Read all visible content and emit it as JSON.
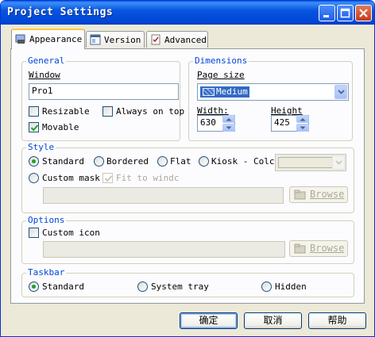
{
  "window": {
    "title": "Project Settings",
    "controls": [
      "minimize-icon",
      "maximize-icon",
      "close-icon"
    ]
  },
  "tabs": [
    {
      "label": "Appearance",
      "icon": "appearance-icon",
      "active": true
    },
    {
      "label": "Version",
      "icon": "version-icon",
      "active": false
    },
    {
      "label": "Advanced",
      "icon": "advanced-icon",
      "active": false
    }
  ],
  "general": {
    "title": "General",
    "window_label": "Window",
    "window_value": "Pro1",
    "resizable_label": "Resizable",
    "resizable_checked": false,
    "always_on_top_label": "Always on top",
    "always_on_top_checked": false,
    "movable_label": "Movable",
    "movable_checked": true
  },
  "dimensions": {
    "title": "Dimensions",
    "page_size_label": "Page size",
    "page_size_value": "Medium",
    "width_label": "Width:",
    "width_value": "630",
    "height_label": "Height",
    "height_value": "425"
  },
  "style": {
    "title": "Style",
    "options": [
      {
        "label": "Standard",
        "selected": true
      },
      {
        "label": "Bordered",
        "selected": false
      },
      {
        "label": "Flat",
        "selected": false
      },
      {
        "label": "Kiosk - Colc",
        "selected": false
      },
      {
        "label": "Custom mask",
        "selected": false
      }
    ],
    "fit_label": "Fit to windc",
    "fit_checked": true,
    "color_value": "",
    "mask_path": "",
    "browse_label": "Browse"
  },
  "options": {
    "title": "Options",
    "custom_icon_label": "Custom icon",
    "custom_icon_checked": false,
    "icon_path": "",
    "browse_label": "Browse"
  },
  "taskbar": {
    "title": "Taskbar",
    "options": [
      {
        "label": "Standard",
        "selected": true
      },
      {
        "label": "System tray",
        "selected": false
      },
      {
        "label": "Hidden",
        "selected": false
      }
    ]
  },
  "buttons": {
    "ok_label": "确定",
    "cancel_label": "取消",
    "help_label": "帮助"
  },
  "colors": {
    "titlebar": "#0054e3",
    "face": "#ece9d8",
    "group_title": "#0046d5",
    "selection": "#316ac5",
    "tab_accent": "#ffc83c"
  }
}
